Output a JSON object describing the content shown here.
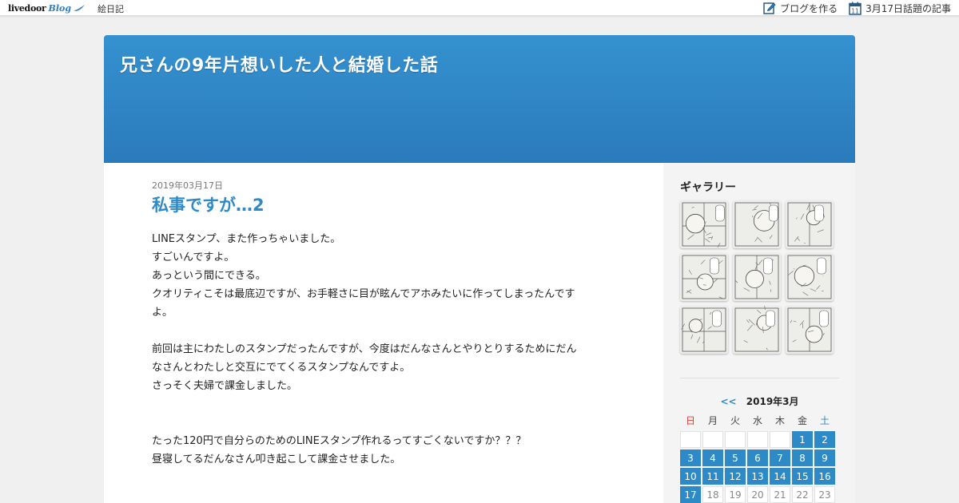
{
  "topbar": {
    "logo_text": "livedoor",
    "logo_blog": "Blog",
    "genre": "絵日記",
    "create_blog": "ブログを作る",
    "topic_articles": "3月17日話題の記事",
    "calendar_icon_day": "11"
  },
  "header": {
    "blog_title": "兄さんの9年片想いした人と結婚した話"
  },
  "post": {
    "date": "2019年03月17日",
    "title": "私事ですが…2",
    "paragraphs": [
      [
        "LINEスタンプ、また作っちゃいました。",
        "すごいんですよ。",
        "あっという間にできる。",
        "クオリティこそは最底辺ですが、お手軽さに目が眩んでアホみたいに作ってしまったんです",
        "よ。"
      ],
      [
        "前回は主にわたしのスタンプだったんですが、今度はだんなさんとやりとりするためにだん",
        "なさんとわたしと交互にでてくるスタンプなんですよ。",
        "さっそく夫婦で課金しました。"
      ],
      [
        "たった120円で自分らのためのLINEスタンプ作れるってすごくないですか？？？",
        "昼寝してるだんなさん叩き起こして課金させました。"
      ]
    ]
  },
  "sidebar": {
    "gallery_title": "ギャラリー",
    "gallery_count": 9
  },
  "calendar": {
    "prev": "<<",
    "month": "2019年3月",
    "weekdays": [
      "日",
      "月",
      "火",
      "水",
      "木",
      "金",
      "土"
    ],
    "leading_blanks": 5,
    "days": [
      {
        "d": "1",
        "a": true
      },
      {
        "d": "2",
        "a": true
      },
      {
        "d": "3",
        "a": true
      },
      {
        "d": "4",
        "a": true
      },
      {
        "d": "5",
        "a": true
      },
      {
        "d": "6",
        "a": true
      },
      {
        "d": "7",
        "a": true
      },
      {
        "d": "8",
        "a": true
      },
      {
        "d": "9",
        "a": true
      },
      {
        "d": "10",
        "a": true
      },
      {
        "d": "11",
        "a": true
      },
      {
        "d": "12",
        "a": true
      },
      {
        "d": "13",
        "a": true
      },
      {
        "d": "14",
        "a": true
      },
      {
        "d": "15",
        "a": true
      },
      {
        "d": "16",
        "a": true
      },
      {
        "d": "17",
        "a": true
      },
      {
        "d": "18",
        "a": false
      },
      {
        "d": "19",
        "a": false
      },
      {
        "d": "20",
        "a": false
      },
      {
        "d": "21",
        "a": false
      },
      {
        "d": "22",
        "a": false
      },
      {
        "d": "23",
        "a": false
      }
    ]
  },
  "colors": {
    "accent": "#2e8ac6",
    "header": "#3591cf",
    "sunday": "#e2403a"
  }
}
